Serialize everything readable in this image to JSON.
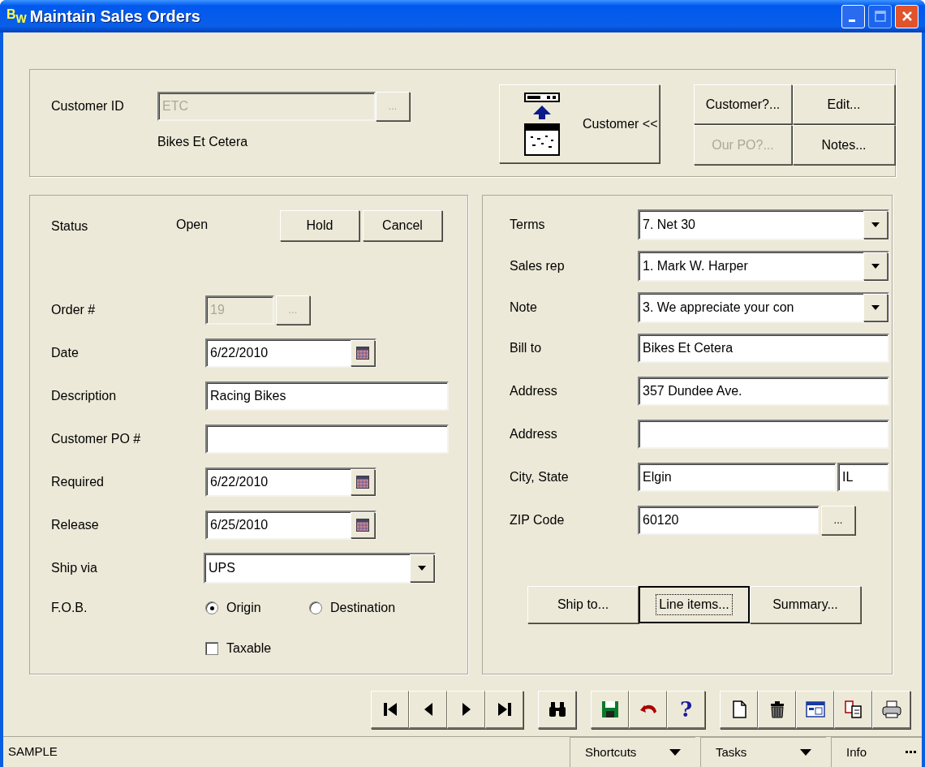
{
  "window": {
    "logo": [
      "B",
      "W"
    ],
    "title": "Maintain Sales Orders",
    "controls": [
      {
        "kind": "minimize",
        "disabled": false
      },
      {
        "kind": "maximize",
        "disabled": true
      },
      {
        "kind": "close",
        "disabled": false
      }
    ]
  },
  "customer": {
    "label": "Customer ID",
    "value": "ETC",
    "disabled": true,
    "lookup": {
      "label": "...",
      "disabled": true
    },
    "name": "Bikes Et Cetera"
  },
  "customer_button": {
    "label": "Customer <<"
  },
  "customer_actions": [
    {
      "label": "Customer?...",
      "disabled": false
    },
    {
      "label": "Edit...",
      "disabled": false
    },
    {
      "label": "Our PO?...",
      "disabled": true
    },
    {
      "label": "Notes...",
      "disabled": false
    }
  ],
  "order": {
    "status_label": "Status",
    "status": "Open",
    "status_buttons": [
      {
        "label": "Hold"
      },
      {
        "label": "Cancel"
      }
    ],
    "fields": [
      {
        "kind": "lookup",
        "label": "Order #",
        "value": "19",
        "disabled": true,
        "button": "..."
      },
      {
        "kind": "date",
        "label": "Date",
        "value": "6/22/2010"
      },
      {
        "kind": "text",
        "label": "Description",
        "value": "Racing Bikes"
      },
      {
        "kind": "text",
        "label": "Customer PO #"
      },
      {
        "kind": "date",
        "label": "Required",
        "value": "6/22/2010"
      },
      {
        "kind": "date",
        "label": "Release",
        "value": "6/25/2010"
      },
      {
        "kind": "combo",
        "label": "Ship via",
        "value": "UPS"
      }
    ],
    "fob": {
      "label": "F.O.B.",
      "options": [
        {
          "label": "Origin",
          "selected": true
        },
        {
          "label": "Destination",
          "selected": false
        }
      ]
    },
    "taxable": {
      "label": "Taxable",
      "checked": false
    }
  },
  "billing": {
    "fields": [
      {
        "kind": "combo",
        "label": "Terms",
        "value": "7. Net 30"
      },
      {
        "kind": "combo",
        "label": "Sales rep",
        "value": "1. Mark W. Harper"
      },
      {
        "kind": "combo",
        "label": "Note",
        "value": "3. We appreciate your con"
      },
      {
        "kind": "text",
        "label": "Bill to",
        "value": "Bikes Et Cetera"
      },
      {
        "kind": "text",
        "label": "Address",
        "value": "357 Dundee Ave."
      },
      {
        "kind": "text",
        "label": "Address"
      },
      {
        "kind": "city_state",
        "label": "City, State",
        "value": "Elgin",
        "state": "IL"
      },
      {
        "kind": "lookup",
        "label": "ZIP Code",
        "value": "60120",
        "button": "...",
        "disabled": false
      }
    ],
    "buttons": [
      {
        "label": "Ship to...",
        "focused": false
      },
      {
        "label": "Line items...",
        "focused": true
      },
      {
        "label": "Summary...",
        "focused": false
      }
    ]
  },
  "toolbar": [
    [
      {
        "kind": "first"
      },
      {
        "kind": "previous"
      },
      {
        "kind": "next"
      },
      {
        "kind": "last"
      }
    ],
    [
      {
        "kind": "find"
      }
    ],
    [
      {
        "kind": "save"
      },
      {
        "kind": "undo"
      },
      {
        "kind": "help",
        "glyph": "?"
      }
    ],
    [
      {
        "kind": "new"
      },
      {
        "kind": "delete"
      },
      {
        "kind": "form"
      },
      {
        "kind": "copy"
      },
      {
        "kind": "print"
      }
    ]
  ],
  "status_bar": {
    "text": "SAMPLE",
    "menus": [
      {
        "label": "Shortcuts",
        "kind": "dropdown"
      },
      {
        "label": "Tasks",
        "kind": "dropdown"
      },
      {
        "label": "Info",
        "kind": "more"
      }
    ]
  }
}
